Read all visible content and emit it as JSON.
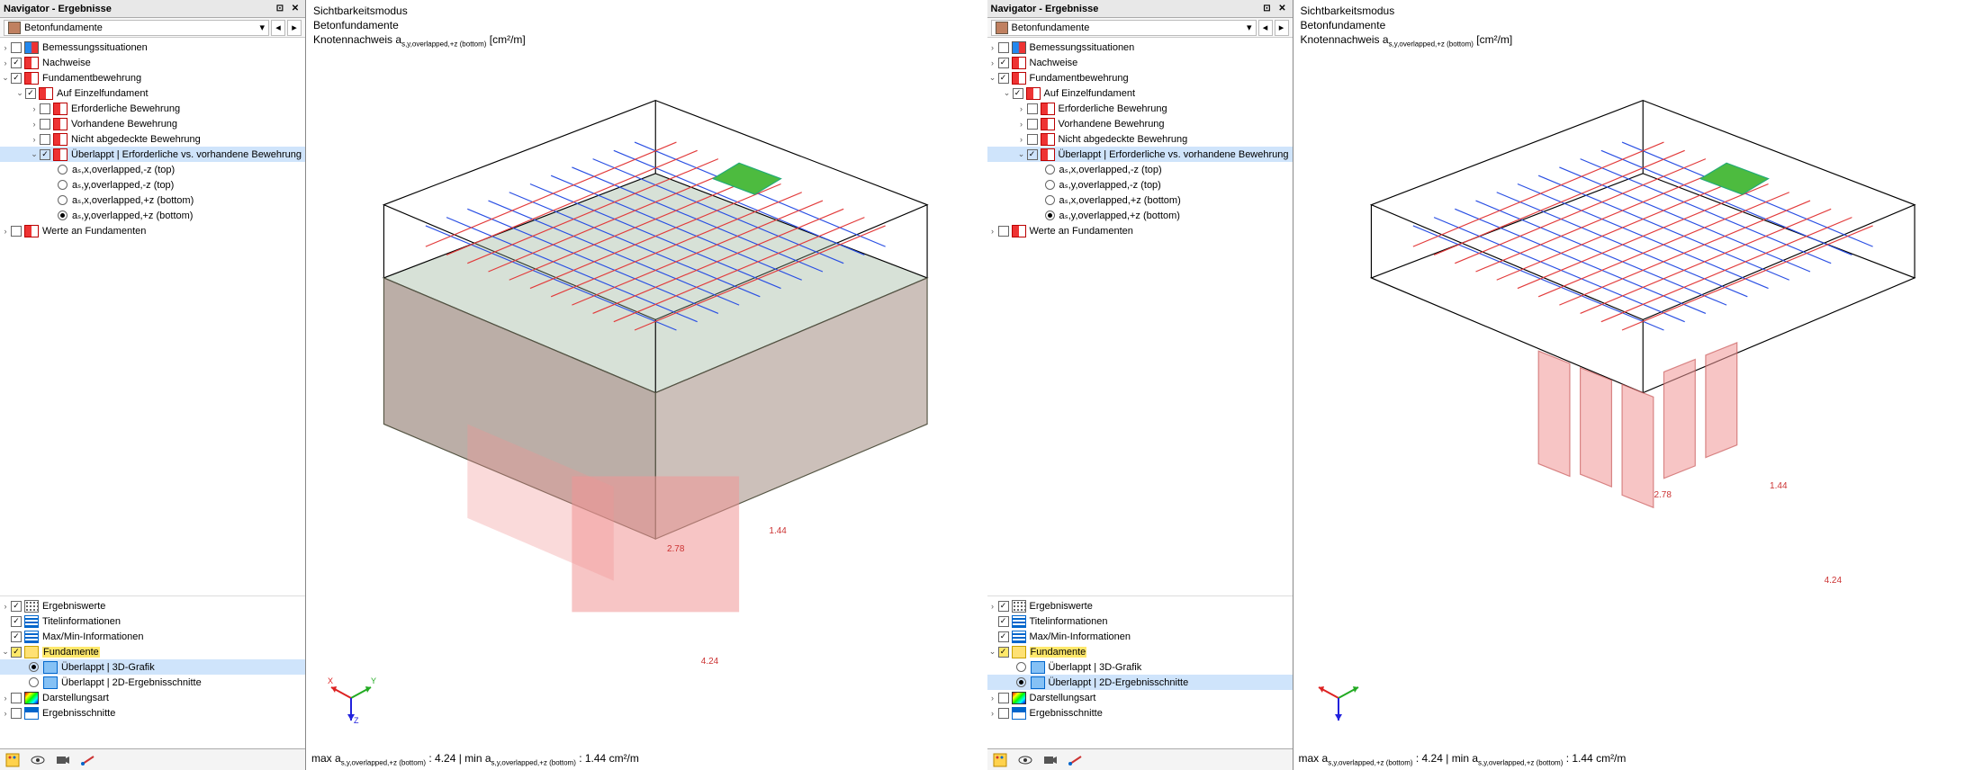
{
  "nav": {
    "title": "Navigator - Ergebnisse",
    "combo": "Betonfundamente",
    "tree_top": {
      "bemessung": "Bemessungssituationen",
      "nachweise": "Nachweise",
      "fundbew": "Fundamentbewehrung",
      "auf_einzel": "Auf Einzelfundament",
      "erf": "Erforderliche Bewehrung",
      "vorh": "Vorhandene Bewehrung",
      "nicht": "Nicht abgedeckte Bewehrung",
      "ueberlappt": "Überlappt | Erforderliche vs. vorhandene Bewehrung",
      "r1": "aₛ,x,overlapped,-z (top)",
      "r2": "aₛ,y,overlapped,-z (top)",
      "r3": "aₛ,x,overlapped,+z (bottom)",
      "r4": "aₛ,y,overlapped,+z (bottom)",
      "werte": "Werte an Fundamenten"
    },
    "tree_bottom": {
      "ergebniswerte": "Ergebniswerte",
      "titel": "Titelinformationen",
      "maxmin": "Max/Min-Informationen",
      "fundamente": "Fundamente",
      "overlap3d": "Überlappt | 3D-Grafik",
      "overlap2d": "Überlappt | 2D-Ergebnisschnitte",
      "darstellung": "Darstellungsart",
      "ergebnisschnitte": "Ergebnisschnitte"
    }
  },
  "viewport": {
    "h1": "Sichtbarkeitsmodus",
    "h2": "Betonfundamente",
    "h3_prefix": "Knotennachweis a",
    "h3_sub": "s,y,overlapped,+z (bottom)",
    "h3_unit": " [cm²/m]",
    "axis": {
      "x": "X",
      "y": "Y",
      "z": "Z"
    },
    "values": {
      "v1": "2.78",
      "v2": "1.44",
      "v3": "4.24"
    },
    "footer_max_prefix": "max a",
    "footer_max_sub": "s,y,overlapped,+z (bottom)",
    "footer_max_val": " : 4.24 | ",
    "footer_min_prefix": "min a",
    "footer_min_sub": "s,y,overlapped,+z (bottom)",
    "footer_min_val": " : 1.44 cm²/m"
  }
}
